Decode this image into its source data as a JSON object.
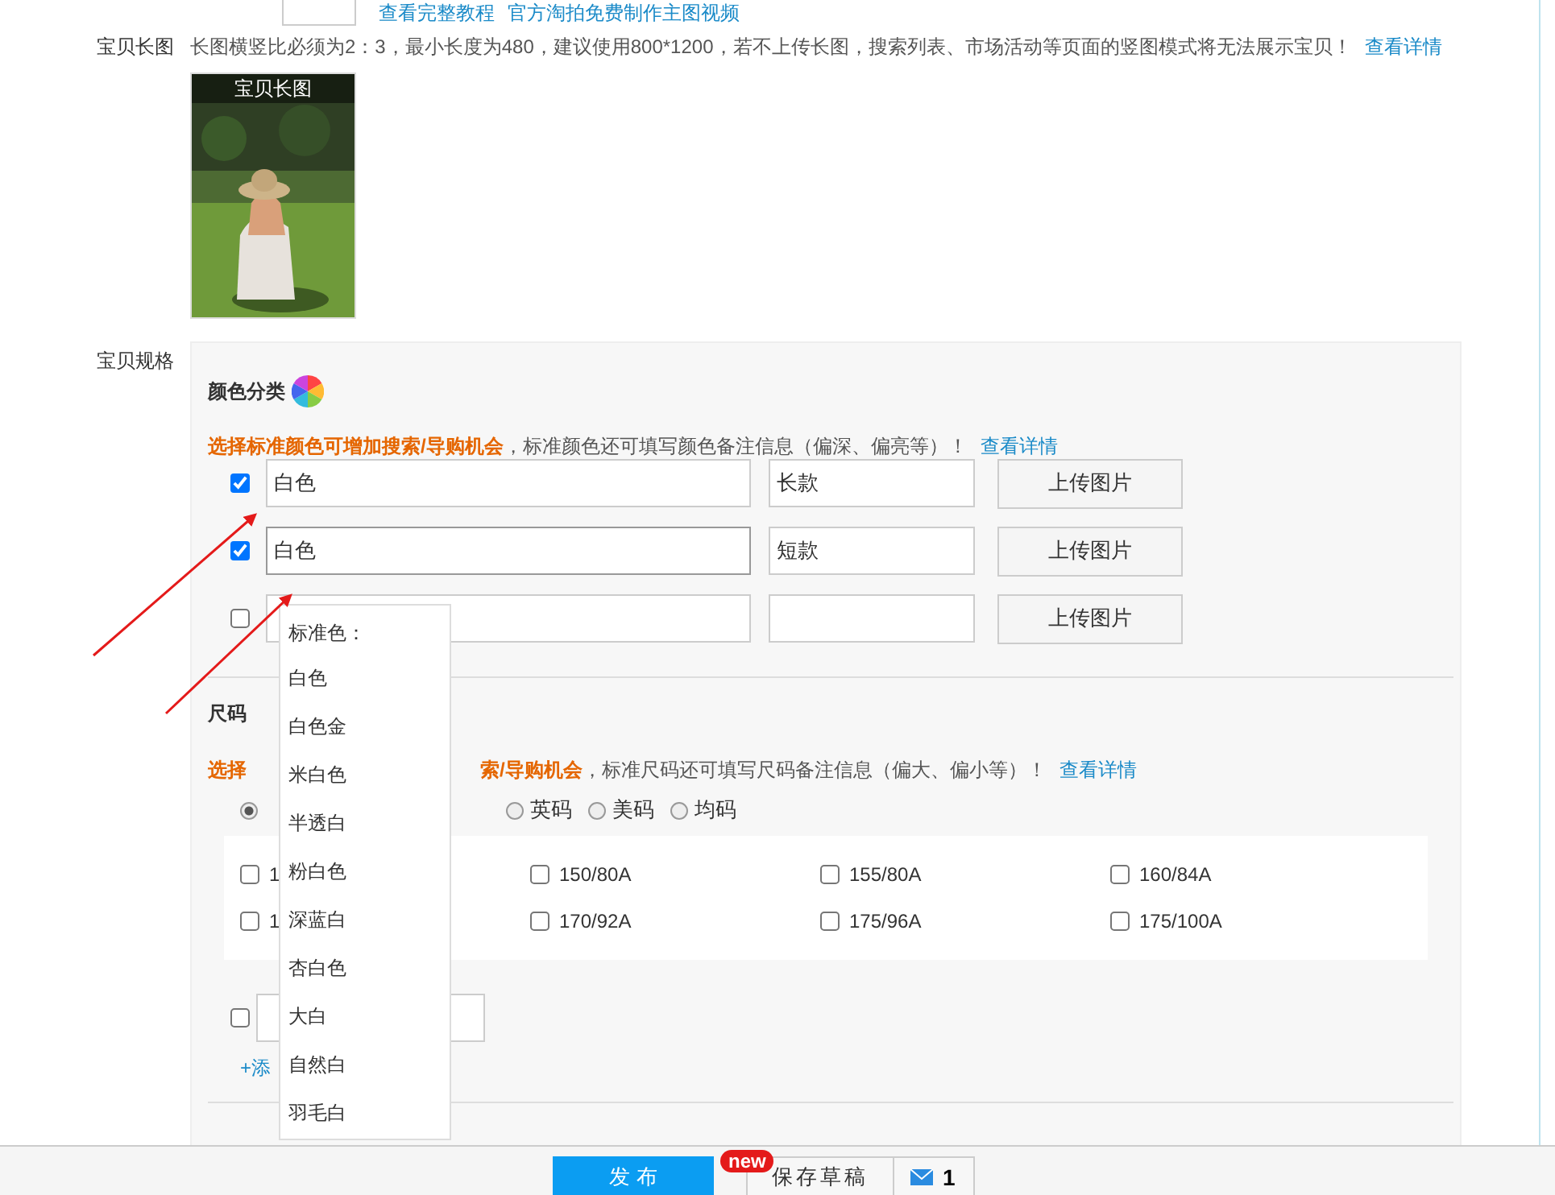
{
  "top_links": [
    "查看完整教程",
    "官方淘拍免费制作主图视频"
  ],
  "long_image": {
    "label": "宝贝长图",
    "hint": "长图横竖比必须为2：3，最小长度为480，建议使用800*1200，若不上传长图，搜索列表、市场活动等页面的竖图模式将无法展示宝贝！",
    "link": "查看详情",
    "caption": "宝贝长图"
  },
  "spec": {
    "label": "宝贝规格",
    "color": {
      "title": "颜色分类",
      "hint_bold": "选择标准颜色可增加搜索/导购机会",
      "hint": "，标准颜色还可填写颜色备注信息（偏深、偏亮等）！",
      "link": "查看详情",
      "rows": [
        {
          "checked": true,
          "value": "白色",
          "note": "长款",
          "button": "上传图片"
        },
        {
          "checked": true,
          "value": "白色",
          "note": "短款",
          "button": "上传图片"
        },
        {
          "checked": false,
          "button": "上传图片"
        }
      ]
    },
    "size": {
      "title": "尺码",
      "hint_start": "选择",
      "hint_bold": "索/导购机会",
      "hint": "，标准尺码还可填写尺码备注信息（偏大、偏小等）！",
      "link": "查看详情",
      "radios": [
        {
          "selected": true
        },
        {
          "label": "英码",
          "selected": false
        },
        {
          "label": "美码",
          "selected": false
        },
        {
          "label": "均码",
          "selected": false
        }
      ],
      "options": [
        {
          "label": "1",
          "checked": false
        },
        {
          "label": "150/80A",
          "checked": false
        },
        {
          "label": "155/80A",
          "checked": false
        },
        {
          "label": "160/84A",
          "checked": false
        },
        {
          "label": "1",
          "checked": false
        },
        {
          "label": "170/92A",
          "checked": false
        },
        {
          "label": "175/96A",
          "checked": false
        },
        {
          "label": "175/100A",
          "checked": false
        }
      ],
      "custom": {
        "checked": false
      },
      "add_link": "+添"
    }
  },
  "dropdown": {
    "title": "标准色：",
    "options": [
      "白色",
      "白色金",
      "米白色",
      "半透白",
      "粉白色",
      "深蓝白",
      "杏白色",
      "大白",
      "自然白",
      "羽毛白"
    ]
  },
  "footer": {
    "publish": "发 布",
    "badge": "new",
    "draft": "保存草稿",
    "count": "1"
  }
}
